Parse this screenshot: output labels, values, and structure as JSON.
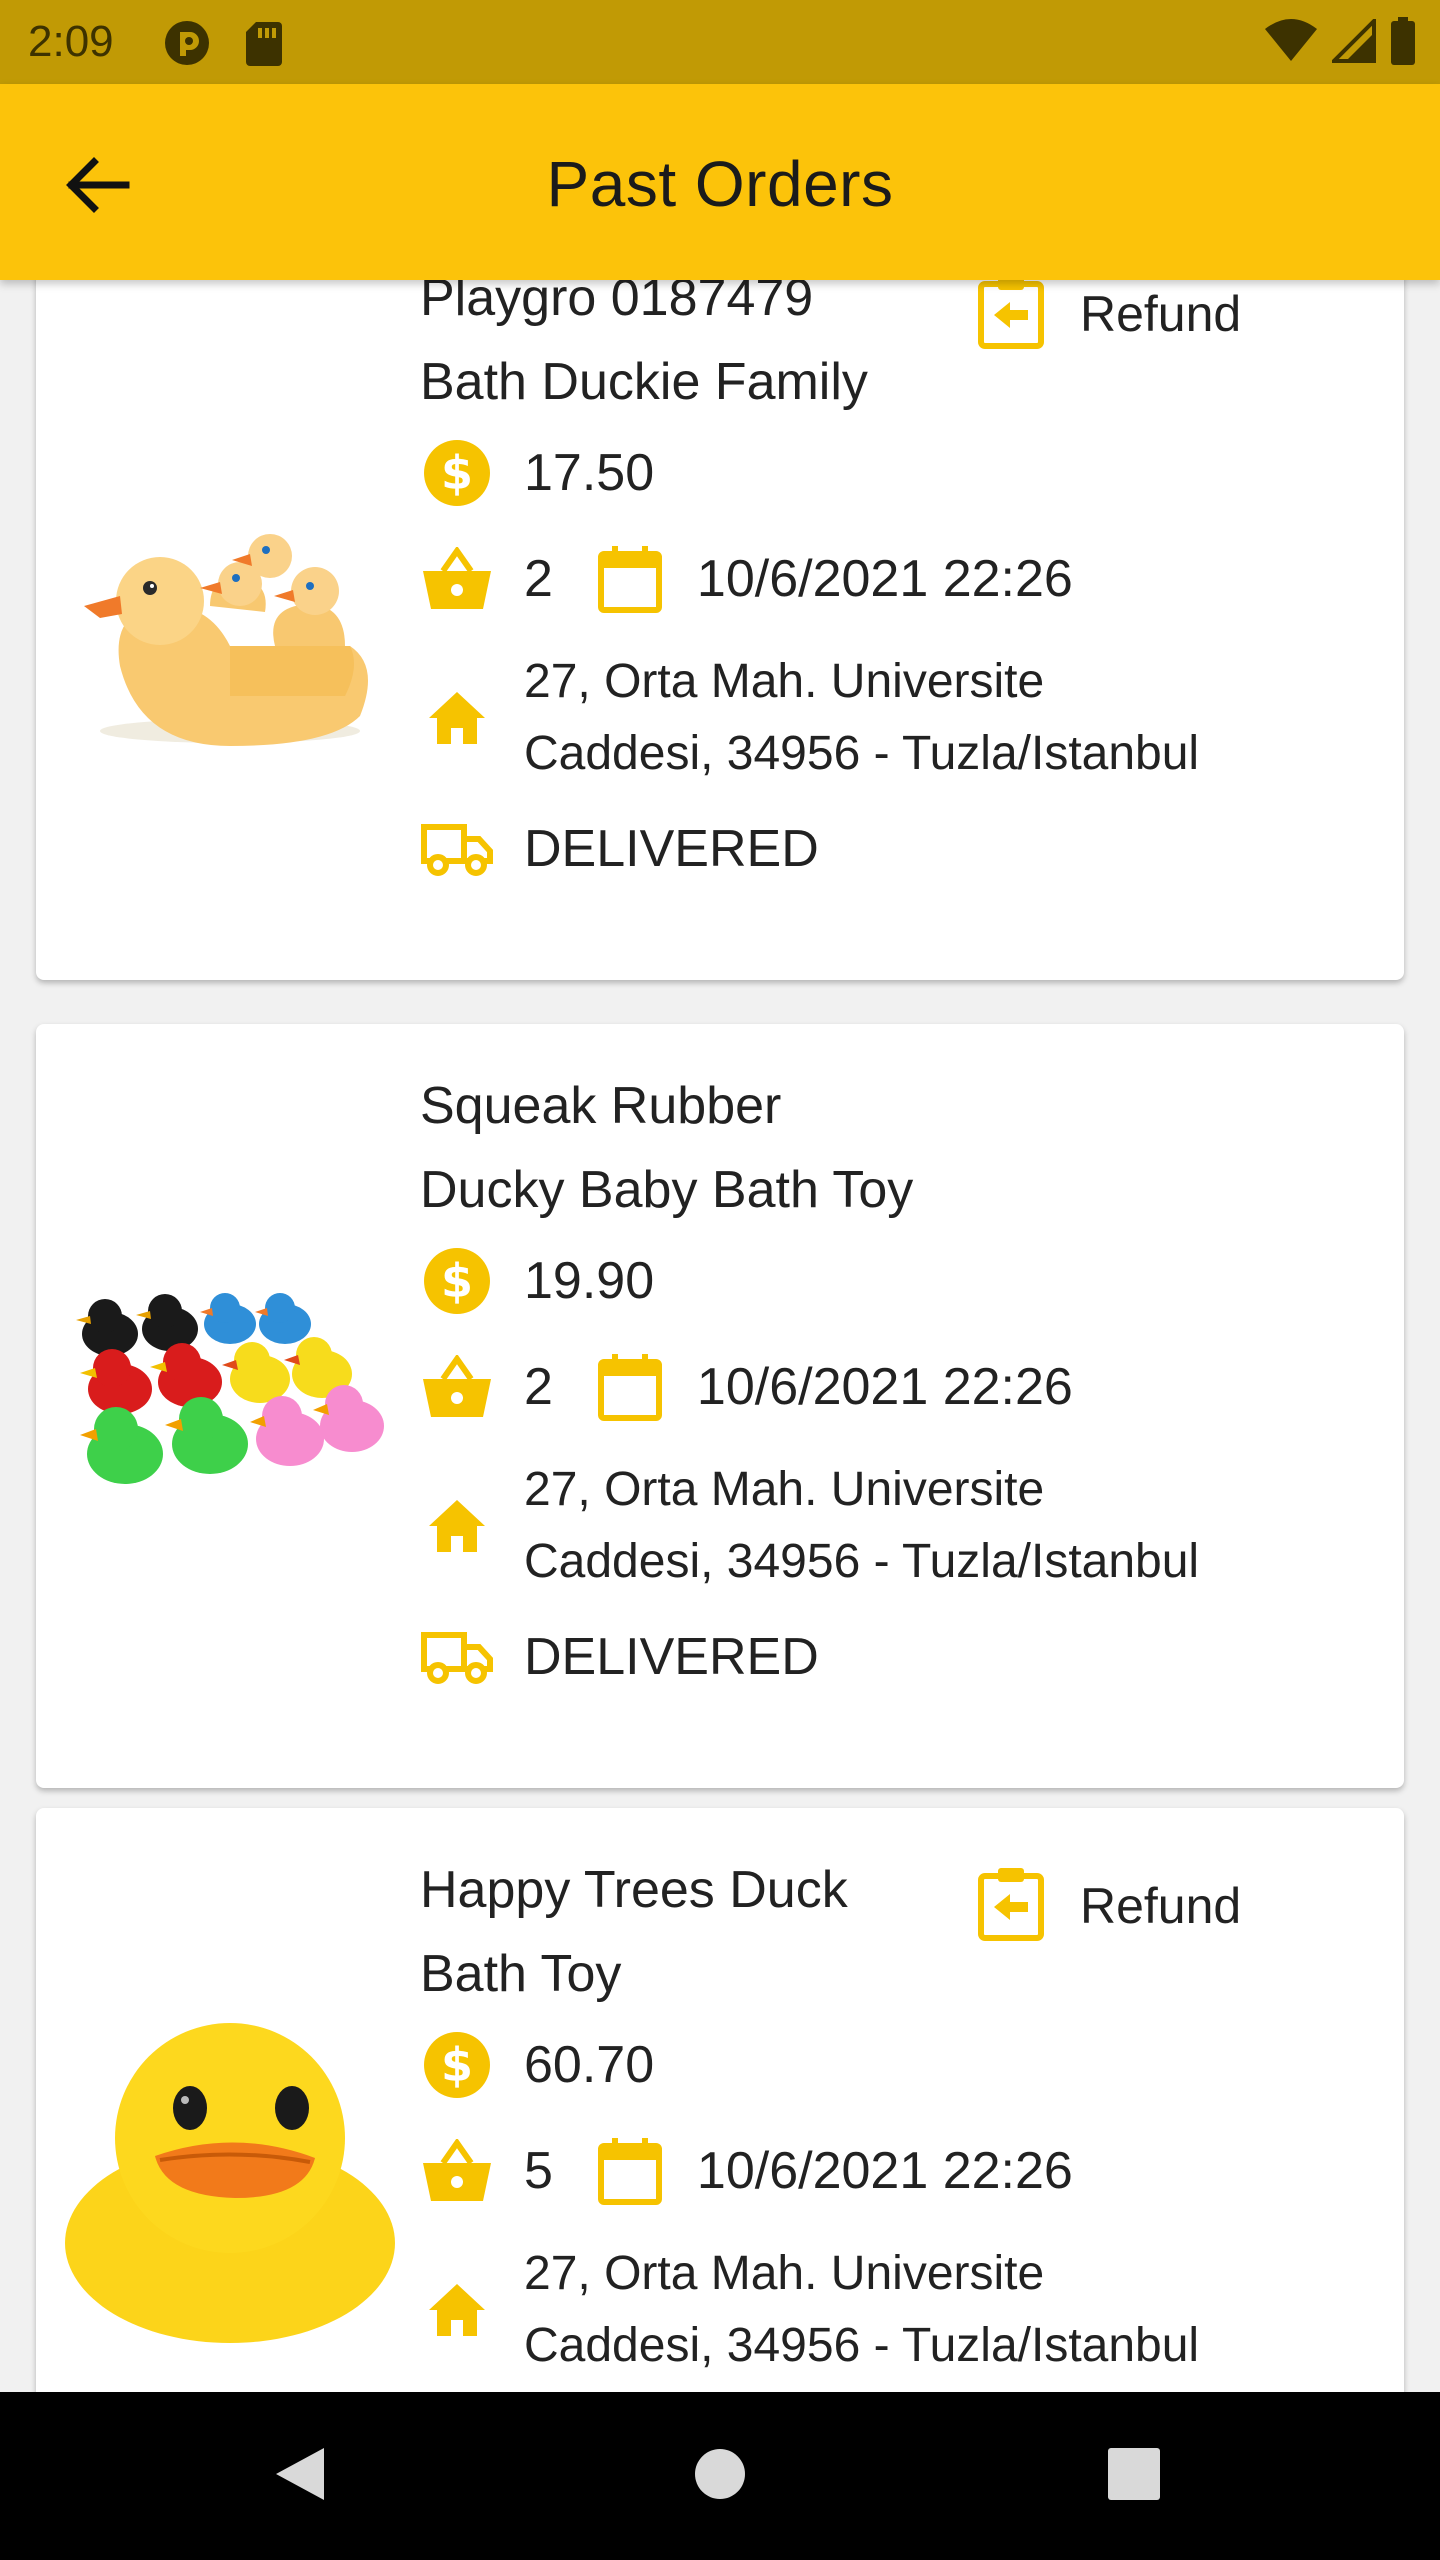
{
  "status_bar": {
    "time": "2:09"
  },
  "app_bar": {
    "title": "Past Orders"
  },
  "colors": {
    "accent": "#fcc30a",
    "icon": "#f6c300",
    "status_bar": "#c19a05"
  },
  "orders": [
    {
      "title_line1": "Playgro 0187479",
      "title_line2": "Bath Duckie Family",
      "refund_label": "Refund",
      "price": "17.50",
      "quantity": "2",
      "date": "10/6/2021 22:26",
      "address_line1": "27, Orta Mah. Universite",
      "address_line2": "Caddesi, 34956 - Tuzla/Istanbul",
      "status": "DELIVERED"
    },
    {
      "title_line1": "Squeak Rubber",
      "title_line2": "Ducky Baby Bath Toy",
      "price": "19.90",
      "quantity": "2",
      "date": "10/6/2021 22:26",
      "address_line1": "27, Orta Mah. Universite",
      "address_line2": "Caddesi, 34956 - Tuzla/Istanbul",
      "status": "DELIVERED"
    },
    {
      "title_line1": "Happy Trees Duck",
      "title_line2": "Bath Toy",
      "refund_label": "Refund",
      "price": "60.70",
      "quantity": "5",
      "date": "10/6/2021 22:26",
      "address_line1": "27, Orta Mah. Universite",
      "address_line2": "Caddesi, 34956 - Tuzla/Istanbul"
    }
  ],
  "icons": {
    "back": "arrow-left-icon",
    "refund": "clipboard-return-icon",
    "price": "dollar-circle-icon",
    "quantity": "basket-icon",
    "date": "calendar-icon",
    "address": "home-icon",
    "status": "truck-icon"
  }
}
